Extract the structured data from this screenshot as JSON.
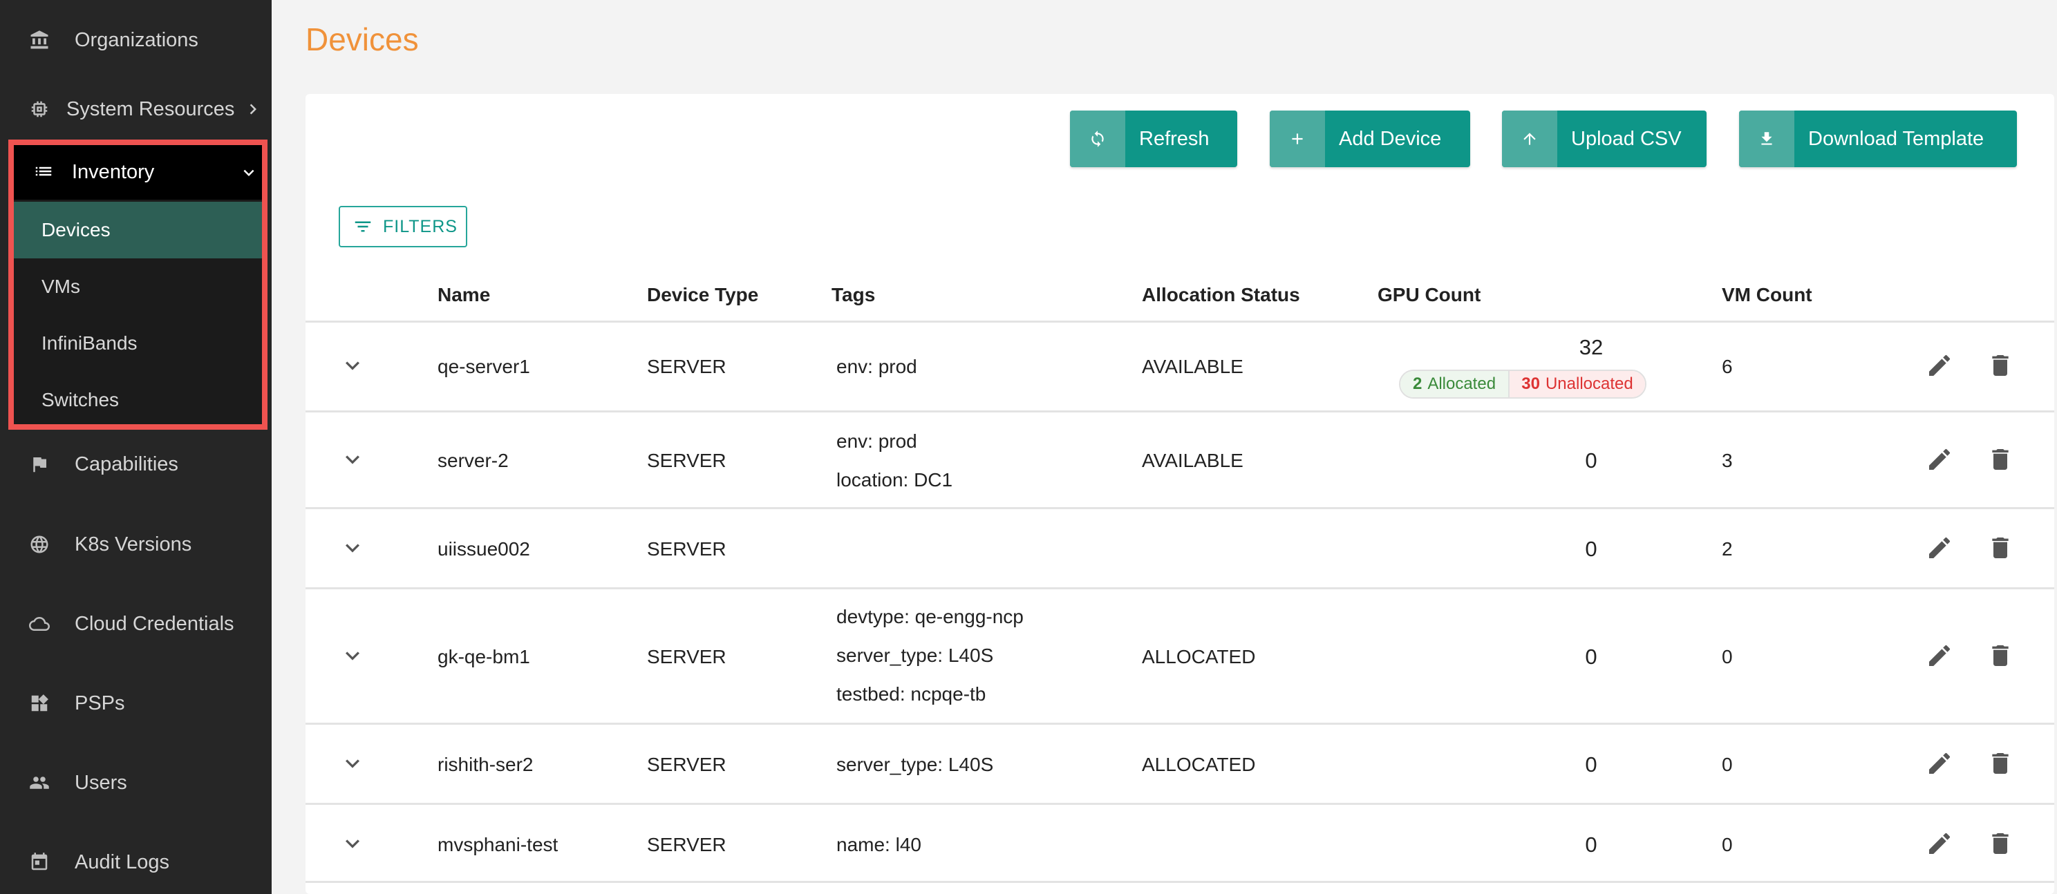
{
  "sidebar": {
    "items": [
      {
        "label": "Organizations",
        "icon": "bank-icon"
      },
      {
        "label": "System Resources",
        "icon": "chip-icon"
      },
      {
        "label": "Capabilities",
        "icon": "flag-icon"
      },
      {
        "label": "K8s Versions",
        "icon": "globe-icon"
      },
      {
        "label": "Cloud Credentials",
        "icon": "cloud-icon"
      },
      {
        "label": "PSPs",
        "icon": "widgets-icon"
      },
      {
        "label": "Users",
        "icon": "people-icon"
      },
      {
        "label": "Audit Logs",
        "icon": "calendar-icon"
      }
    ],
    "inventory": {
      "label": "Inventory",
      "children": [
        "Devices",
        "VMs",
        "InfiniBands",
        "Switches"
      ],
      "active": "Devices"
    }
  },
  "page": {
    "title": "Devices"
  },
  "toolbar": {
    "refresh": "Refresh",
    "add_device": "Add Device",
    "upload_csv": "Upload CSV",
    "download_template": "Download Template",
    "filters": "FILTERS"
  },
  "table": {
    "headers": {
      "name": "Name",
      "device_type": "Device Type",
      "tags": "Tags",
      "allocation_status": "Allocation Status",
      "gpu_count": "GPU Count",
      "vm_count": "VM Count"
    },
    "rows": [
      {
        "name": "qe-server1",
        "type": "SERVER",
        "tags": [
          "env: prod"
        ],
        "status": "AVAILABLE",
        "gpu": "32",
        "allocated": "2",
        "allocated_label": "Allocated",
        "unallocated": "30",
        "unallocated_label": "Unallocated",
        "vm": "6"
      },
      {
        "name": "server-2",
        "type": "SERVER",
        "tags": [
          "env: prod",
          "location: DC1"
        ],
        "status": "AVAILABLE",
        "gpu": "0",
        "vm": "3"
      },
      {
        "name": "uiissue002",
        "type": "SERVER",
        "tags": [],
        "status": "",
        "gpu": "0",
        "vm": "2"
      },
      {
        "name": "gk-qe-bm1",
        "type": "SERVER",
        "tags": [
          "devtype: qe-engg-ncp",
          "server_type: L40S",
          "testbed: ncpqe-tb"
        ],
        "status": "ALLOCATED",
        "gpu": "0",
        "vm": "0"
      },
      {
        "name": "rishith-ser2",
        "type": "SERVER",
        "tags": [
          "server_type: L40S"
        ],
        "status": "ALLOCATED",
        "gpu": "0",
        "vm": "0"
      },
      {
        "name": "mvsphani-test",
        "type": "SERVER",
        "tags": [
          "name: l40"
        ],
        "status": "",
        "gpu": "0",
        "vm": "0"
      }
    ]
  },
  "colors": {
    "accent": "#0e9688",
    "title": "#f0923a",
    "sidebar_bg": "#262626",
    "highlight_border": "#ef5350"
  }
}
